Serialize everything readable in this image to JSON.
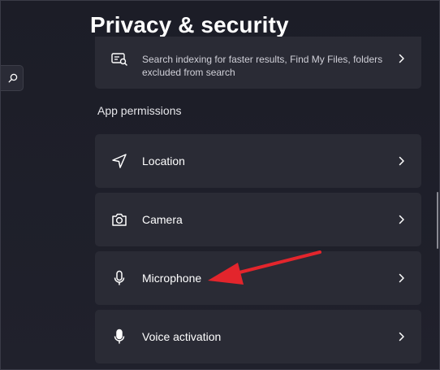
{
  "page": {
    "title": "Privacy & security"
  },
  "search_item": {
    "description": "Search indexing for faster results, Find My Files, folders excluded from search",
    "icon": "search-indexing-icon"
  },
  "sections": {
    "app_permissions_title": "App permissions"
  },
  "permissions": [
    {
      "label": "Location",
      "icon": "location-arrow-icon"
    },
    {
      "label": "Camera",
      "icon": "camera-icon"
    },
    {
      "label": "Microphone",
      "icon": "microphone-icon"
    },
    {
      "label": "Voice activation",
      "icon": "voice-activation-icon"
    }
  ],
  "annotation": {
    "arrow_color": "#e3252c",
    "points_to": "Microphone"
  },
  "colors": {
    "background": "#1e1f2a",
    "card": "#2a2b35",
    "text": "#ffffff"
  }
}
